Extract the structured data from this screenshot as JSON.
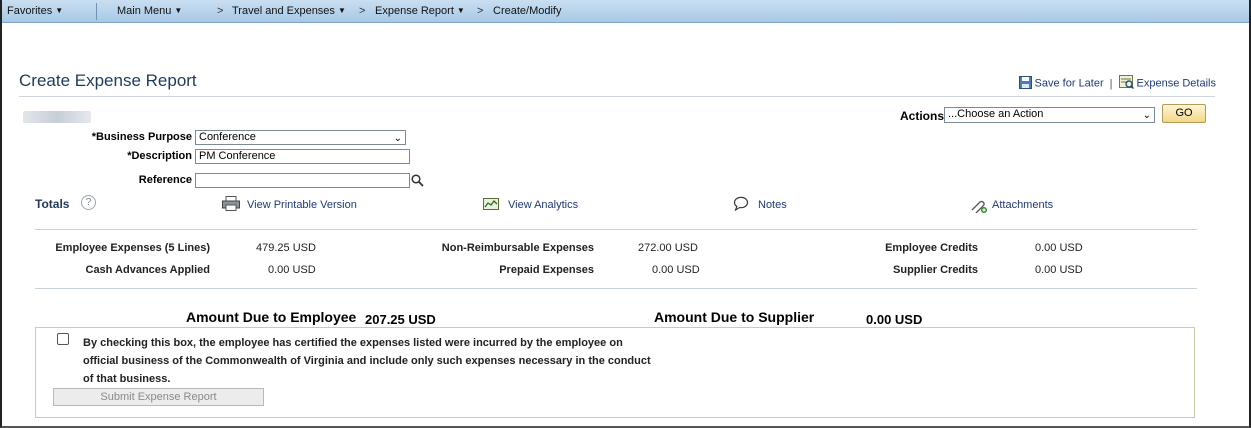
{
  "nav": {
    "favorites": "Favorites",
    "main_menu": "Main Menu",
    "crumb_sep": ">",
    "crumbs": [
      "Travel and Expenses",
      "Expense Report",
      "Create/Modify"
    ]
  },
  "header": {
    "title": "Create Expense Report",
    "save_for_later": "Save for Later",
    "separator": "|",
    "expense_details": "Expense Details"
  },
  "form": {
    "business_purpose_label": "*Business Purpose",
    "business_purpose_value": "Conference",
    "description_label": "*Description",
    "description_value": "PM Conference",
    "reference_label": "Reference",
    "reference_value": ""
  },
  "actions": {
    "label": "Actions",
    "select_value": "...Choose an Action",
    "go_label": "GO"
  },
  "totals": {
    "label": "Totals",
    "help_glyph": "?",
    "links": {
      "printable": "View Printable Version",
      "analytics": "View Analytics",
      "notes": "Notes",
      "attachments": "Attachments"
    }
  },
  "summary": {
    "employee_expenses_label": "Employee Expenses (5 Lines)",
    "employee_expenses_value": "479.25  USD",
    "cash_advances_label": "Cash Advances Applied",
    "cash_advances_value": "0.00  USD",
    "non_reimbursable_label": "Non-Reimbursable Expenses",
    "non_reimbursable_value": "272.00  USD",
    "prepaid_label": "Prepaid Expenses",
    "prepaid_value": "0.00  USD",
    "employee_credits_label": "Employee Credits",
    "employee_credits_value": "0.00  USD",
    "supplier_credits_label": "Supplier Credits",
    "supplier_credits_value": "0.00  USD"
  },
  "due": {
    "employee_label": "Amount Due to Employee",
    "employee_value": "207.25  USD",
    "supplier_label": "Amount Due to Supplier",
    "supplier_value": "0.00  USD"
  },
  "certification": {
    "line1": "By checking this box, the employee has certified the expenses listed were incurred by the employee on",
    "line2": "official business of the Commonwealth of Virginia and include only such expenses necessary in the conduct",
    "line3": "of that business.",
    "submit_label": "Submit Expense Report",
    "checked": false
  },
  "colors": {
    "nav_bg": "#b8d4ec",
    "title_color": "#1f3a5a",
    "link_color": "#1f3a78",
    "go_button_bg": "#f2d78a"
  }
}
